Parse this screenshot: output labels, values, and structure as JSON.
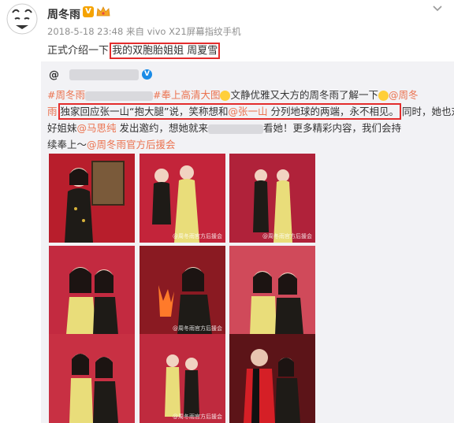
{
  "header": {
    "username": "周冬雨",
    "v_badge": "V",
    "meta": "2018-5-18 23:48 来自 vivo X21屏幕指纹手机",
    "text_before": "正式介绍一下 ",
    "text_highlight": "我的双胞胎姐姐 周夏雪"
  },
  "repost": {
    "author_prefix": "@",
    "line1_tag": "#周冬雨",
    "line1_mid": "#奉上高清大图",
    "line1_rest": "文静优雅又大方的周冬雨了解一下",
    "line1_mention": "@周冬",
    "line2_start": "雨",
    "line2_highlight_a": "独家回应张一山“抱大腿”说，笑称想和",
    "line2_mention": "@张一山",
    "line2_highlight_b": " 分列地球的两端，永不相见。",
    "line2_end": "同时，她也对",
    "line3_start": "好姐妹",
    "line3_mention": "@马思纯",
    "line3_mid": " 发出邀约，想她就来",
    "line3_end": "看她！更多精彩内容，我们会持",
    "line4_start": "续奉上～",
    "line4_mention": "@周冬雨官方后援会"
  },
  "photos": [
    {
      "label": "photo-1",
      "bg": "#b81e2c"
    },
    {
      "label": "photo-2",
      "bg": "#c3243a"
    },
    {
      "label": "photo-3",
      "bg": "#b0223a"
    },
    {
      "label": "photo-4",
      "bg": "#c32a40"
    },
    {
      "label": "photo-5",
      "bg": "#8a1a22"
    },
    {
      "label": "photo-6",
      "bg": "#d04a5a"
    },
    {
      "label": "photo-7",
      "bg": "#c83043"
    },
    {
      "label": "photo-8",
      "bg": "#bf2a3e"
    },
    {
      "label": "photo-9",
      "bg": "#5c1418"
    }
  ],
  "watermark": "@周冬雨官方后援会",
  "colors": {
    "link": "#eb7350",
    "highlight_box": "#e32c2c",
    "repost_bg": "#f2f2f5",
    "meta": "#909090"
  }
}
